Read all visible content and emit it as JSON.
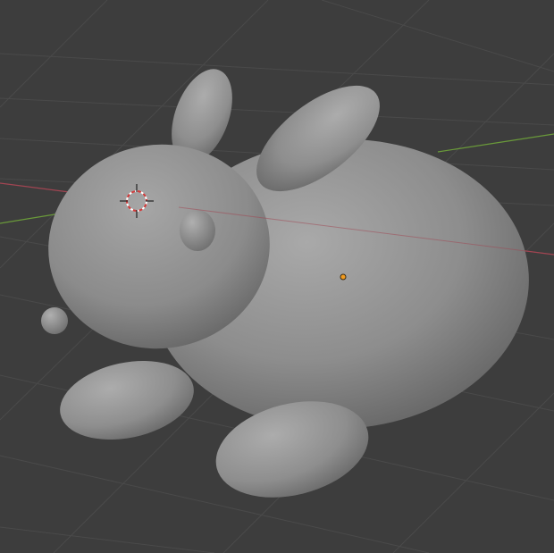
{
  "viewport": {
    "background": "#3d3d3d",
    "grid_color": "#4a4a4a",
    "x_axis_color": "#a14552",
    "y_axis_color": "#6a9a3a",
    "grid_visible": true
  },
  "scene": {
    "object": "rabbit-mesh",
    "shading": "solid",
    "base_color": "#8a8a8a",
    "cursor_3d_visible": true,
    "origin_marker_color": "#f29b1f"
  }
}
